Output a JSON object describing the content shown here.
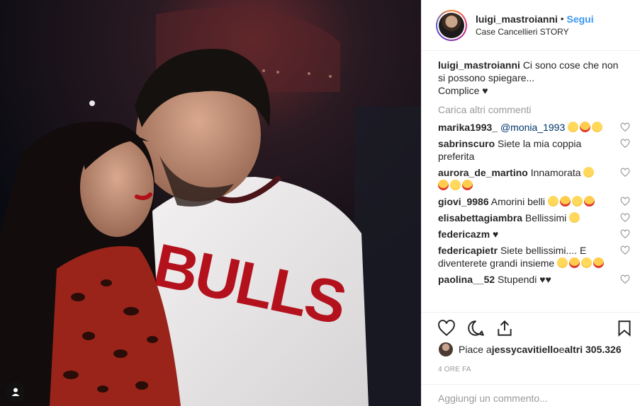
{
  "header": {
    "username": "luigi_mastroianni",
    "separator": "•",
    "follow_label": "Segui",
    "location": "Case Cancellieri STORY"
  },
  "caption": {
    "username": "luigi_mastroianni",
    "text": "Ci sono cose che non si possono spiegare...",
    "text2": "Complice ♥"
  },
  "load_more_label": "Carica altri commenti",
  "comments": [
    {
      "user": "marika1993_",
      "mention": "@monia_1993",
      "text": "",
      "emoji": 3
    },
    {
      "user": "sabrinscuro",
      "mention": "",
      "text": "Siete la mia coppia preferita",
      "emoji": 0
    },
    {
      "user": "aurora_de_martino",
      "mention": "",
      "text": "Innamorata",
      "emoji": 4
    },
    {
      "user": "giovi_9986",
      "mention": "",
      "text": "Amorini belli",
      "emoji": 4
    },
    {
      "user": "elisabettagiambra",
      "mention": "",
      "text": "Bellissimi",
      "emoji": 1
    },
    {
      "user": "federicazm",
      "mention": "",
      "text": "♥",
      "emoji": 0
    },
    {
      "user": "federicapietr",
      "mention": "",
      "text": "Siete bellissimi.... E diventerete grandi insieme",
      "emoji": 4
    },
    {
      "user": "paolina__52",
      "mention": "",
      "text": "Stupendi ♥♥",
      "emoji": 0
    }
  ],
  "likes": {
    "prefix": "Piace a ",
    "user": "jessycavitiello",
    "middle": " e ",
    "count": "altri 305.326"
  },
  "time_ago": "4 ORE FA",
  "add_comment_placeholder": "Aggiungi un commento...",
  "photo": {
    "shirt_text": "BULLS"
  },
  "colors": {
    "link_blue": "#3897f0",
    "mention_blue": "#003569",
    "muted": "#999999",
    "text": "#262626",
    "border": "#efefef"
  }
}
